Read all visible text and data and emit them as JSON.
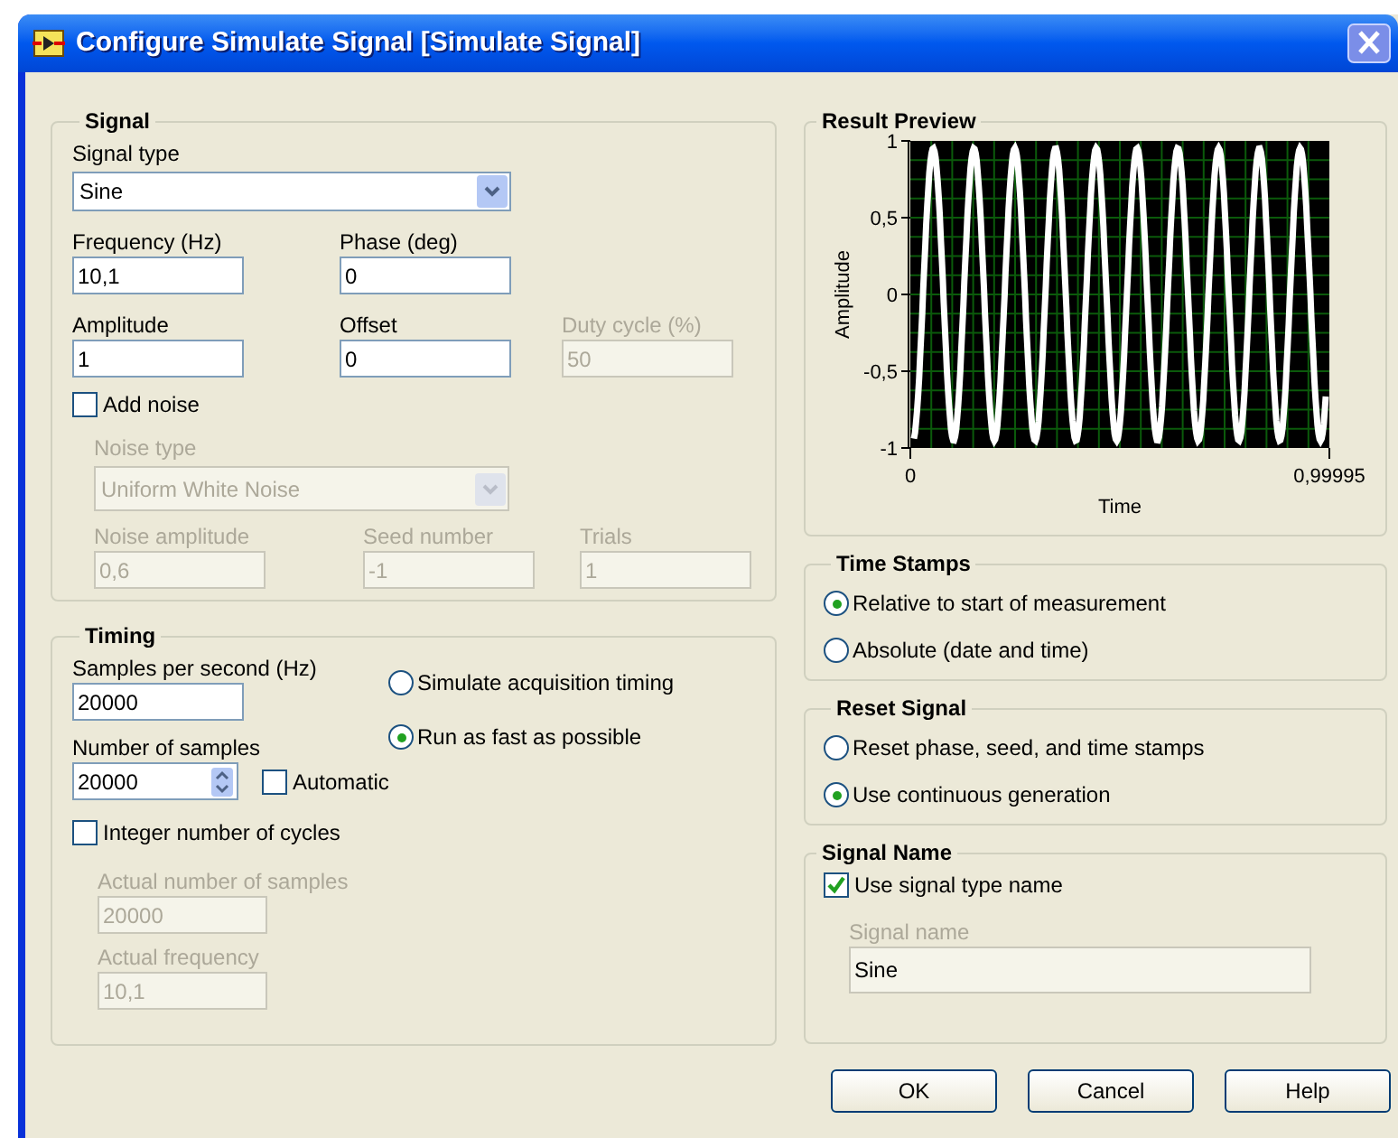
{
  "window": {
    "title": "Configure Simulate Signal [Simulate Signal]"
  },
  "signal": {
    "title": "Signal",
    "signal_type": {
      "label": "Signal type",
      "value": "Sine",
      "disabled": false
    },
    "rows": [
      [
        {
          "label": "Frequency (Hz)",
          "value": "10,1",
          "disabled": false
        },
        {
          "label": "Phase (deg)",
          "value": "0",
          "disabled": false
        }
      ],
      [
        {
          "label": "Amplitude",
          "value": "1",
          "disabled": false
        },
        {
          "label": "Offset",
          "value": "0",
          "disabled": false
        },
        {
          "label": "Duty cycle (%)",
          "value": "50",
          "disabled": true
        }
      ]
    ],
    "add_noise": {
      "label": "Add noise",
      "checked": false
    },
    "noise_type": {
      "label": "Noise type",
      "value": "Uniform White Noise",
      "disabled": true
    },
    "noise_fields": [
      {
        "label": "Noise amplitude",
        "value": "0,6",
        "disabled": true
      },
      {
        "label": "Seed number",
        "value": "-1",
        "disabled": true
      },
      {
        "label": "Trials",
        "value": "1",
        "disabled": true
      }
    ]
  },
  "timing": {
    "title": "Timing",
    "samples_per_second": {
      "label": "Samples per second (Hz)",
      "value": "20000",
      "disabled": false
    },
    "number_of_samples": {
      "label": "Number of samples",
      "value": "20000",
      "disabled": false
    },
    "automatic": {
      "label": "Automatic",
      "checked": false
    },
    "modes": [
      {
        "label": "Simulate acquisition timing",
        "selected": false
      },
      {
        "label": "Run as fast as possible",
        "selected": true
      }
    ],
    "integer_cycles": {
      "label": "Integer number of cycles",
      "checked": false
    },
    "actual_fields": [
      {
        "label": "Actual number of samples",
        "value": "20000",
        "disabled": true
      },
      {
        "label": "Actual frequency",
        "value": "10,1",
        "disabled": true
      }
    ]
  },
  "result_preview": {
    "title": "Result Preview",
    "ylabel": "Amplitude",
    "xlabel": "Time",
    "y_tick_labels": [
      "1",
      "0,5",
      "0",
      "-0,5",
      "-1"
    ],
    "x_tick_labels": [
      "0",
      "0,99995"
    ]
  },
  "time_stamps": {
    "title": "Time Stamps",
    "options": [
      {
        "label": "Relative to start of measurement",
        "selected": true
      },
      {
        "label": "Absolute (date and time)",
        "selected": false
      }
    ]
  },
  "reset_signal": {
    "title": "Reset Signal",
    "options": [
      {
        "label": "Reset phase, seed, and time stamps",
        "selected": false
      },
      {
        "label": "Use continuous generation",
        "selected": true
      }
    ]
  },
  "signal_name": {
    "title": "Signal Name",
    "use_type_name": {
      "label": "Use signal type name",
      "checked": true
    },
    "field": {
      "label": "Signal name",
      "value": "Sine",
      "disabled": true
    }
  },
  "buttons": [
    "OK",
    "Cancel",
    "Help"
  ]
}
